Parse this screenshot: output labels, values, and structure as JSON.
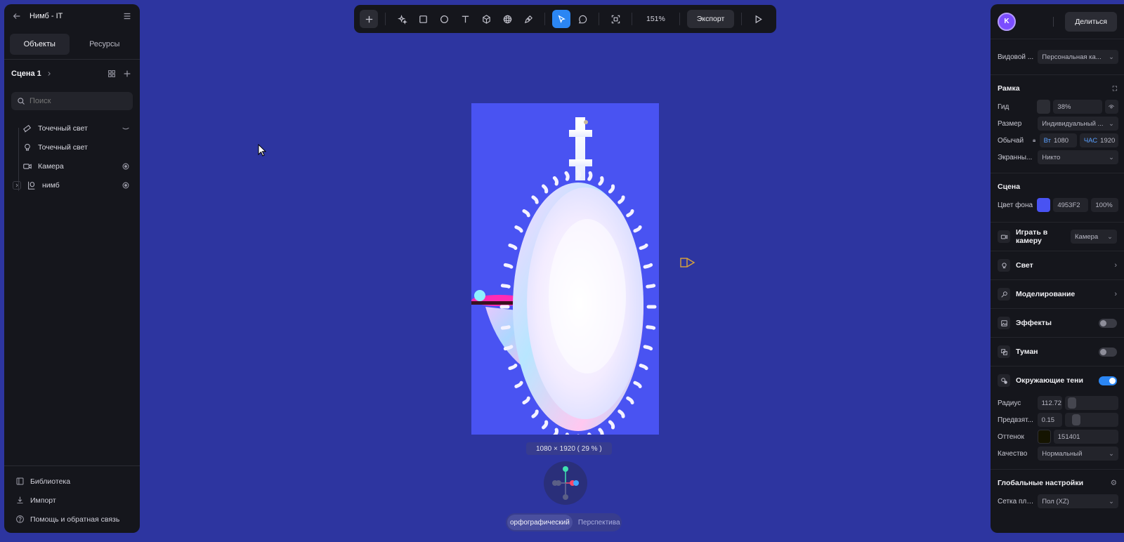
{
  "left_panel": {
    "project_title": "Нимб - IT",
    "tabs": [
      {
        "label": "Объекты",
        "active": true
      },
      {
        "label": "Ресурсы",
        "active": false
      }
    ],
    "scene_label": "Сцена 1",
    "search_placeholder": "Поиск",
    "tree": [
      {
        "name": "Точечный свет",
        "icon": "spotlight-icon"
      },
      {
        "name": "Точечный свет",
        "icon": "bulb-icon"
      },
      {
        "name": "Камера",
        "icon": "camera-icon"
      },
      {
        "name": "нимб",
        "icon": "group-icon"
      }
    ],
    "footer": [
      {
        "label": "Библиотека",
        "icon": "library-icon"
      },
      {
        "label": "Импорт",
        "icon": "import-icon"
      },
      {
        "label": "Помощь и обратная связь",
        "icon": "help-icon"
      }
    ]
  },
  "toolbar": {
    "zoom": "151%",
    "export_label": "Экспорт",
    "tools": [
      "plus-icon",
      "magic-icon",
      "rectangle-icon",
      "ellipse-icon",
      "text-icon",
      "cube-icon",
      "sphere-icon",
      "pen-icon",
      "pointer-icon",
      "comment-icon",
      "frame-focus-icon",
      "play-icon"
    ]
  },
  "canvas": {
    "frame_background": "#4953f2",
    "size_badge": "1080 × 1920 ( 29 % )",
    "view_modes": [
      {
        "label": "орфографический",
        "active": true
      },
      {
        "label": "Перспектива",
        "active": false
      }
    ]
  },
  "right_panel": {
    "avatar_letter": "K",
    "share_label": "Делиться",
    "view_label": "Видовой ...",
    "view_value": "Персональная ка...",
    "frame_section": "Рамка",
    "guide_label": "Гид",
    "guide_value": "38%",
    "size_label": "Размер",
    "size_value": "Индивидуальный ...",
    "normal_label": "Обычай",
    "width_prefix": "Вт",
    "width_value": "1080",
    "height_prefix": "ЧАС",
    "height_value": "1920",
    "screen_label": "Экранны...",
    "screen_value": "Никто",
    "scene_section": "Сцена",
    "bg_label": "Цвет фона",
    "bg_color": "#4953f2",
    "bg_hex": "4953F2",
    "bg_opacity": "100%",
    "play_camera_label": "Играть в камеру",
    "play_camera_value": "Камера",
    "light_label": "Свет",
    "modeling_label": "Моделирование",
    "effects_label": "Эффекты",
    "fog_label": "Туман",
    "ao_label": "Окружающие тени",
    "ao_enabled": true,
    "radius_label": "Радиус",
    "radius_value": "112.72",
    "bias_label": "Предвзят...",
    "bias_value": "0.15",
    "tint_label": "Оттенок",
    "tint_color": "#151401",
    "tint_hex": "151401",
    "quality_label": "Качество",
    "quality_value": "Нормальный",
    "global_section": "Глобальные настройки",
    "grid_label": "Сетка пло...",
    "grid_value": "Пол (XZ)"
  }
}
